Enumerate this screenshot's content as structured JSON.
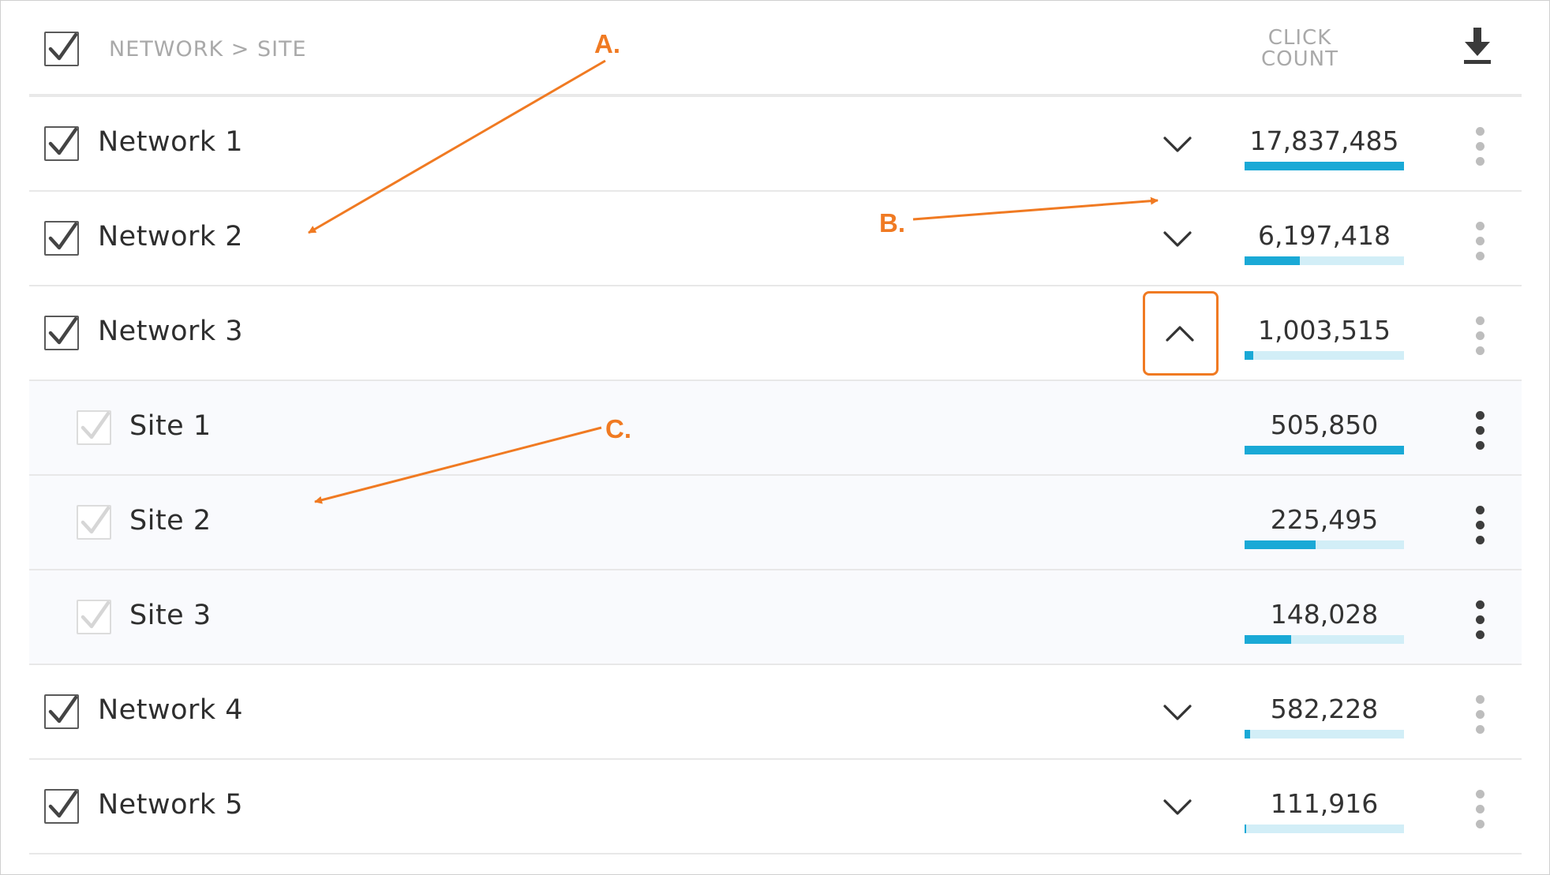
{
  "header": {
    "label": "NETWORK > SITE",
    "count_line1": "CLICK",
    "count_line2": "COUNT",
    "download_icon": "download-icon"
  },
  "rows": [
    {
      "type": "network",
      "name": "Network 1",
      "count": "17,837,485",
      "bar_fraction": 1.0,
      "expanded": false
    },
    {
      "type": "network",
      "name": "Network 2",
      "count": "6,197,418",
      "bar_fraction": 0.347,
      "expanded": false
    },
    {
      "type": "network",
      "name": "Network 3",
      "count": "1,003,515",
      "bar_fraction": 0.056,
      "expanded": true
    },
    {
      "type": "site",
      "name": "Site 1",
      "count": "505,850",
      "bar_fraction": 1.0
    },
    {
      "type": "site",
      "name": "Site 2",
      "count": "225,495",
      "bar_fraction": 0.446
    },
    {
      "type": "site",
      "name": "Site 3",
      "count": "148,028",
      "bar_fraction": 0.293
    },
    {
      "type": "network",
      "name": "Network 4",
      "count": "582,228",
      "bar_fraction": 0.033,
      "expanded": false
    },
    {
      "type": "network",
      "name": "Network 5",
      "count": "111,916",
      "bar_fraction": 0.006,
      "expanded": false
    }
  ],
  "annotations": {
    "a": "A.",
    "b": "B.",
    "c": "C."
  },
  "colors": {
    "accent": "#f07a22",
    "bar_fill": "#1aa9d6",
    "bar_track": "#d2eef7"
  }
}
